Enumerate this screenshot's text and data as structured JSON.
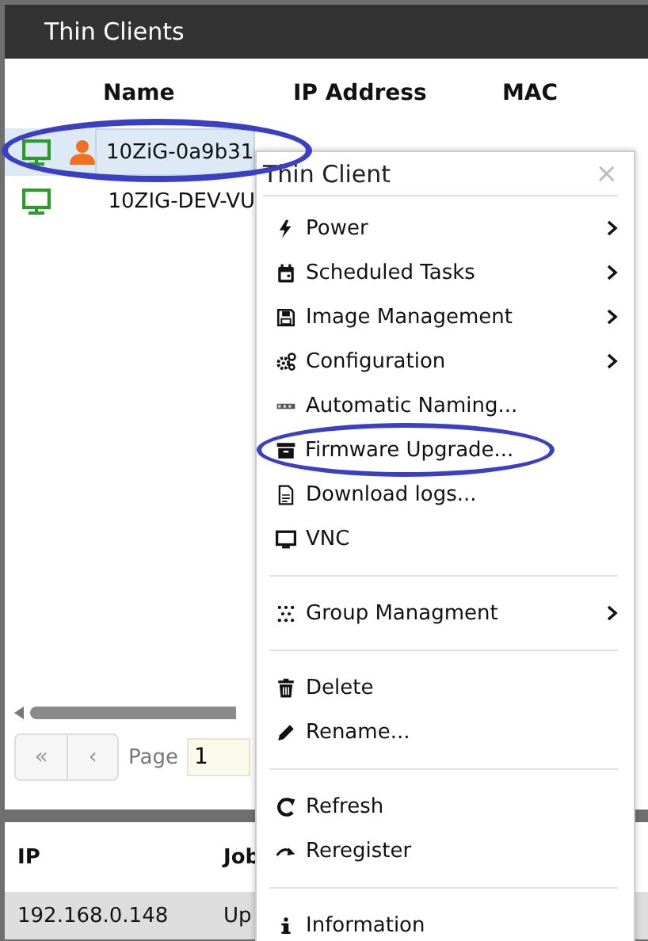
{
  "panel": {
    "title": "Thin Clients"
  },
  "table": {
    "columns": [
      "Name",
      "IP Address",
      "MAC"
    ],
    "rows": [
      {
        "name": "10ZiG-0a9b31",
        "user_logged_in": true,
        "selected": true,
        "highlighted": true
      },
      {
        "name": "10ZIG-DEV-VU",
        "user_logged_in": false,
        "selected": false,
        "highlighted": false
      }
    ]
  },
  "pager": {
    "first": "«",
    "prev": "‹",
    "label": "Page",
    "value": "1"
  },
  "jobs": {
    "columns": [
      "IP",
      "Job"
    ],
    "rows": [
      {
        "ip": "192.168.0.148",
        "job": "Up"
      }
    ]
  },
  "menu": {
    "title": "Thin Client",
    "close": "×",
    "items": [
      {
        "kind": "item",
        "label": "Power",
        "submenu": true,
        "highlighted": false
      },
      {
        "kind": "item",
        "label": "Scheduled Tasks",
        "submenu": true,
        "highlighted": false
      },
      {
        "kind": "item",
        "label": "Image Management",
        "submenu": true,
        "highlighted": false
      },
      {
        "kind": "item",
        "label": "Configuration",
        "submenu": true,
        "highlighted": false
      },
      {
        "kind": "item",
        "label": "Automatic Naming...",
        "submenu": false,
        "highlighted": false
      },
      {
        "kind": "item",
        "label": "Firmware Upgrade...",
        "submenu": false,
        "highlighted": true
      },
      {
        "kind": "item",
        "label": "Download logs...",
        "submenu": false,
        "highlighted": false
      },
      {
        "kind": "item",
        "label": "VNC",
        "submenu": false,
        "highlighted": false
      },
      {
        "kind": "separator"
      },
      {
        "kind": "item",
        "label": "Group Managment",
        "submenu": true,
        "highlighted": false
      },
      {
        "kind": "separator"
      },
      {
        "kind": "item",
        "label": "Delete",
        "submenu": false,
        "highlighted": false
      },
      {
        "kind": "item",
        "label": "Rename...",
        "submenu": false,
        "highlighted": false
      },
      {
        "kind": "separator"
      },
      {
        "kind": "item",
        "label": "Refresh",
        "submenu": false,
        "highlighted": false
      },
      {
        "kind": "item",
        "label": "Reregister",
        "submenu": false,
        "highlighted": false
      },
      {
        "kind": "separator"
      },
      {
        "kind": "item",
        "label": "Information",
        "submenu": false,
        "highlighted": false
      }
    ]
  }
}
